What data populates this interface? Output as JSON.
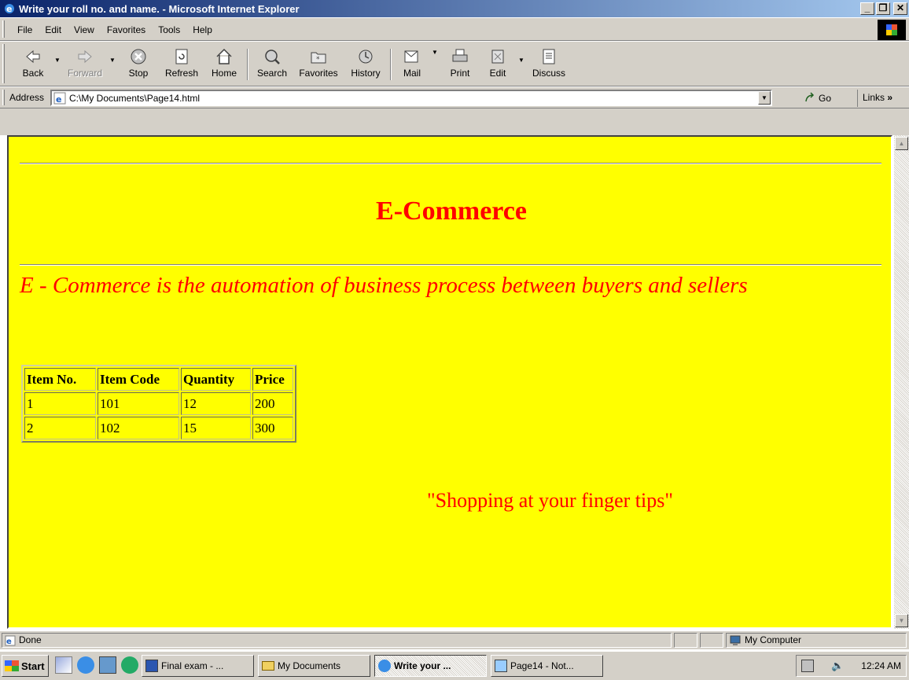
{
  "window": {
    "title": "Write your roll no. and name. - Microsoft Internet Explorer"
  },
  "menu": [
    "File",
    "Edit",
    "View",
    "Favorites",
    "Tools",
    "Help"
  ],
  "toolbar": {
    "back": "Back",
    "forward": "Forward",
    "stop": "Stop",
    "refresh": "Refresh",
    "home": "Home",
    "search": "Search",
    "favorites": "Favorites",
    "history": "History",
    "mail": "Mail",
    "print": "Print",
    "edit": "Edit",
    "discuss": "Discuss"
  },
  "address": {
    "label": "Address",
    "url": "C:\\My Documents\\Page14.html",
    "go": "Go",
    "links": "Links"
  },
  "page": {
    "heading": "E-Commerce",
    "intro": "E - Commerce is the automation of business process between buyers and sellers",
    "table": {
      "headers": [
        "Item No.",
        "Item Code",
        "Quantity",
        "Price"
      ],
      "rows": [
        [
          "1",
          "101",
          "12",
          "200"
        ],
        [
          "2",
          "102",
          "15",
          "300"
        ]
      ]
    },
    "tagline": "\"Shopping at your finger tips\""
  },
  "status": {
    "text": "Done",
    "zone": "My Computer"
  },
  "taskbar": {
    "start": "Start",
    "tasks": [
      "Final exam - ...",
      "My Documents",
      "Write your ...",
      "Page14 - Not..."
    ],
    "clock": "12:24 AM"
  },
  "colors": {
    "page_bg": "#ffff00",
    "page_text": "#ff0000",
    "title_bar": "#0a246a"
  }
}
